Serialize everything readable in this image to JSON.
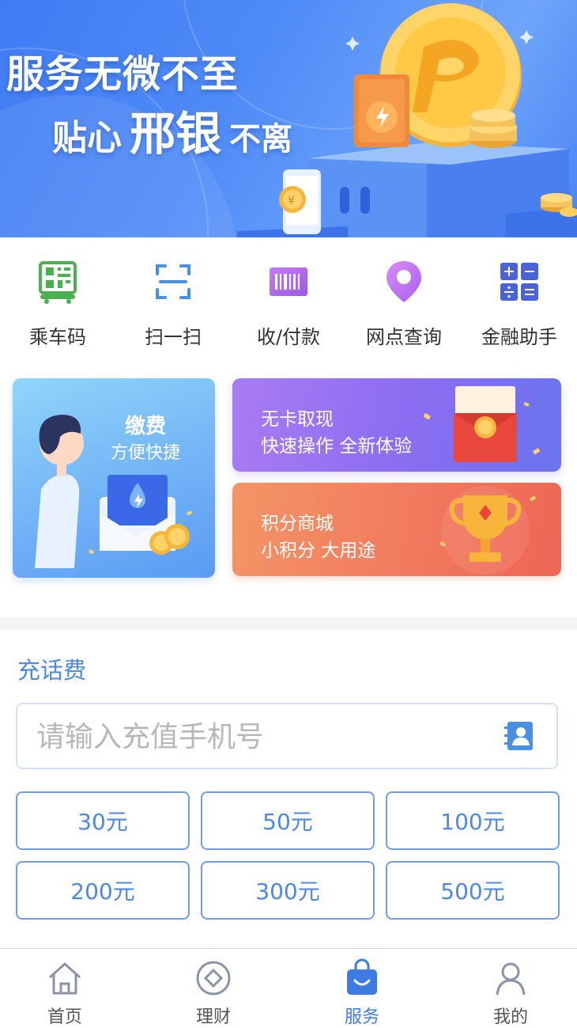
{
  "banner": {
    "line1": "服务无微不至",
    "line2_part1": "贴心",
    "line2_brand": "邢银",
    "line2_part2": "不离"
  },
  "quick_actions": [
    {
      "label": "乘车码",
      "icon": "bus-qr-icon"
    },
    {
      "label": "扫一扫",
      "icon": "scan-icon"
    },
    {
      "label": "收/付款",
      "icon": "barcode-icon"
    },
    {
      "label": "网点查询",
      "icon": "location-pin-icon"
    },
    {
      "label": "金融助手",
      "icon": "calculator-icon"
    }
  ],
  "promo": {
    "payment": {
      "title": "缴费",
      "subtitle": "方便快捷"
    },
    "cardless": {
      "title": "无卡取现",
      "subtitle": "快速操作 全新体验"
    },
    "points": {
      "title": "积分商城",
      "subtitle": "小积分 大用途"
    }
  },
  "recharge": {
    "title": "充话费",
    "phone_placeholder": "请输入充值手机号",
    "phone_value": "",
    "amounts": [
      "30元",
      "50元",
      "100元",
      "200元",
      "300元",
      "500元"
    ]
  },
  "tabbar": {
    "tabs": [
      {
        "label": "首页",
        "icon": "home-icon"
      },
      {
        "label": "理财",
        "icon": "wealth-icon"
      },
      {
        "label": "服务",
        "icon": "service-bag-icon",
        "active": true
      },
      {
        "label": "我的",
        "icon": "profile-icon"
      }
    ]
  },
  "colors": {
    "accent": "#4d88e6",
    "tab_active": "#3e7be3",
    "card_payment": "#7ab6f5",
    "card_cardless": "#8f6df0",
    "card_points": "#f07a5c"
  }
}
